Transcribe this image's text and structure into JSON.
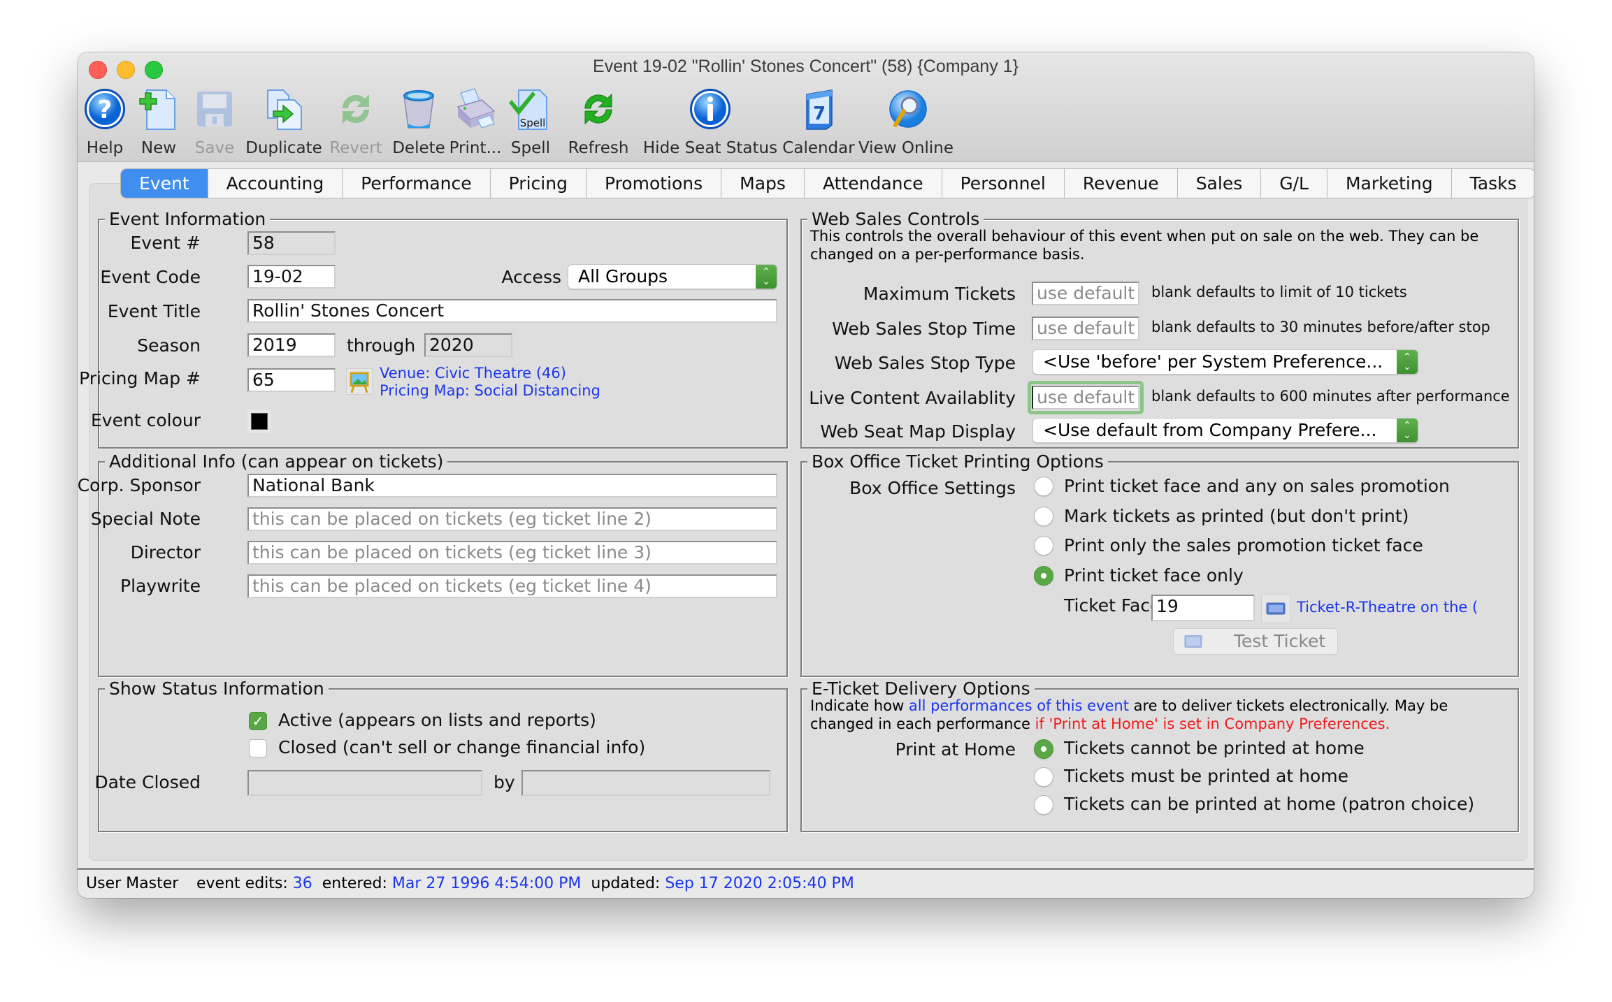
{
  "window": {
    "title": "Event 19-02 \"Rollin' Stones Concert\" (58) {Company 1}",
    "traffic_lights": {
      "close": "#fe5f57",
      "minimize": "#febc2e",
      "zoom": "#28c840"
    }
  },
  "toolbar": {
    "items": [
      {
        "label": "Help",
        "icon": "help-icon",
        "enabled": true
      },
      {
        "label": "New",
        "icon": "new-document-icon",
        "enabled": true
      },
      {
        "label": "Save",
        "icon": "save-disk-icon",
        "enabled": false
      },
      {
        "label": "Duplicate",
        "icon": "duplicate-icon",
        "enabled": true
      },
      {
        "label": "Revert",
        "icon": "revert-icon",
        "enabled": false
      },
      {
        "label": "Delete",
        "icon": "trash-icon",
        "enabled": true
      },
      {
        "label": "Print...",
        "icon": "printer-icon",
        "enabled": true
      },
      {
        "label": "Spell",
        "icon": "spellcheck-icon",
        "enabled": true,
        "icon_text": "Spell"
      },
      {
        "label": "Refresh",
        "icon": "refresh-icon",
        "enabled": true
      },
      {
        "label": "Hide Seat Status",
        "icon": "info-icon",
        "enabled": true
      },
      {
        "label": "Calendar",
        "icon": "calendar-icon",
        "enabled": true,
        "icon_text": "7"
      },
      {
        "label": "View Online",
        "icon": "view-online-icon",
        "enabled": true
      }
    ]
  },
  "tabs": {
    "active": "Event",
    "items": [
      "Event",
      "Accounting",
      "Performance",
      "Pricing",
      "Promotions",
      "Maps",
      "Attendance",
      "Personnel",
      "Revenue",
      "Sales",
      "G/L",
      "Marketing",
      "Tasks"
    ]
  },
  "event_info": {
    "title": "Event Information",
    "event_num_label": "Event #",
    "event_num": "58",
    "event_code_label": "Event Code",
    "event_code": "19-02",
    "access_label": "Access",
    "access_value": "All Groups",
    "event_title_label": "Event Title",
    "event_title": "Rollin' Stones Concert",
    "season_label": "Season",
    "season_from": "2019",
    "through_label": "through",
    "season_to": "2020",
    "pricing_map_label": "Pricing Map #",
    "pricing_map": "65",
    "venue_link": "Venue: Civic Theatre (46)",
    "pricing_map_link": "Pricing Map: Social Distancing",
    "event_colour_label": "Event colour",
    "event_colour": "#000000"
  },
  "additional_info": {
    "title": "Additional Info (can appear on tickets)",
    "corp_sponsor_label": "Corp. Sponsor",
    "corp_sponsor": "National Bank",
    "special_note_label": "Special Note",
    "special_note_placeholder": "this can be placed on tickets (eg ticket line 2)",
    "director_label": "Director",
    "director_placeholder": "this can be placed on tickets (eg ticket line 3)",
    "playwrite_label": "Playwrite",
    "playwrite_placeholder": "this can be placed on tickets (eg ticket line 4)"
  },
  "show_status": {
    "title": "Show Status Information",
    "active_label": "Active (appears on lists and reports)",
    "active_checked": true,
    "closed_label": "Closed (can't sell or change financial info)",
    "closed_checked": false,
    "date_closed_label": "Date Closed",
    "date_closed": "",
    "by_label": "by",
    "closed_by": ""
  },
  "web_sales": {
    "title": "Web Sales Controls",
    "description": "This controls the overall behaviour of this event when put on sale on the web.  They can be changed on a per-performance basis.",
    "max_tickets_label": "Maximum Tickets",
    "max_tickets_placeholder": "use default",
    "max_tickets_hint": "blank defaults to limit of 10 tickets",
    "stop_time_label": "Web Sales Stop Time",
    "stop_time_placeholder": "use default",
    "stop_time_hint": "blank defaults to 30 minutes before/after stop",
    "stop_type_label": "Web Sales Stop Type",
    "stop_type_value": "<Use 'before' per System Preference...",
    "live_content_label": "Live Content Availablity",
    "live_content_placeholder": "use default",
    "live_content_hint": "blank defaults to 600 minutes after performance",
    "seat_map_label": "Web Seat Map Display",
    "seat_map_value": "<Use default from Company Prefere..."
  },
  "box_office": {
    "title": "Box Office Ticket Printing Options",
    "settings_label": "Box Office Settings",
    "options": [
      {
        "label": "Print ticket face and any on sales promotion",
        "selected": false
      },
      {
        "label": "Mark tickets as printed (but don't print)",
        "selected": false
      },
      {
        "label": "Print only the sales promotion ticket face",
        "selected": false
      },
      {
        "label": "Print ticket face only",
        "selected": true
      }
    ],
    "ticket_face_label": "Ticket Face",
    "ticket_face": "19",
    "ticket_face_link": "Ticket-R-Theatre on the (",
    "test_ticket_label": "Test Ticket"
  },
  "eticket": {
    "title": "E-Ticket Delivery Options",
    "desc_part1": "Indicate how ",
    "desc_link": "all performances of this event",
    "desc_part2": " are to deliver tickets electronically.  May be",
    "desc_part3": "changed in each performance ",
    "desc_red": "if 'Print at Home' is set in Company Preferences.",
    "print_at_home_label": "Print at Home",
    "options": [
      {
        "label": "Tickets cannot be printed at home",
        "selected": true
      },
      {
        "label": "Tickets must be printed at home",
        "selected": false
      },
      {
        "label": "Tickets can be printed at home (patron choice)",
        "selected": false
      }
    ]
  },
  "status_bar": {
    "user": "User Master",
    "edits_label": "event edits:",
    "edits": "36",
    "entered_label": "entered:",
    "entered": "Mar 27 1996 4:54:00 PM",
    "updated_label": "updated:",
    "updated": "Sep 17 2020 2:05:40 PM"
  }
}
